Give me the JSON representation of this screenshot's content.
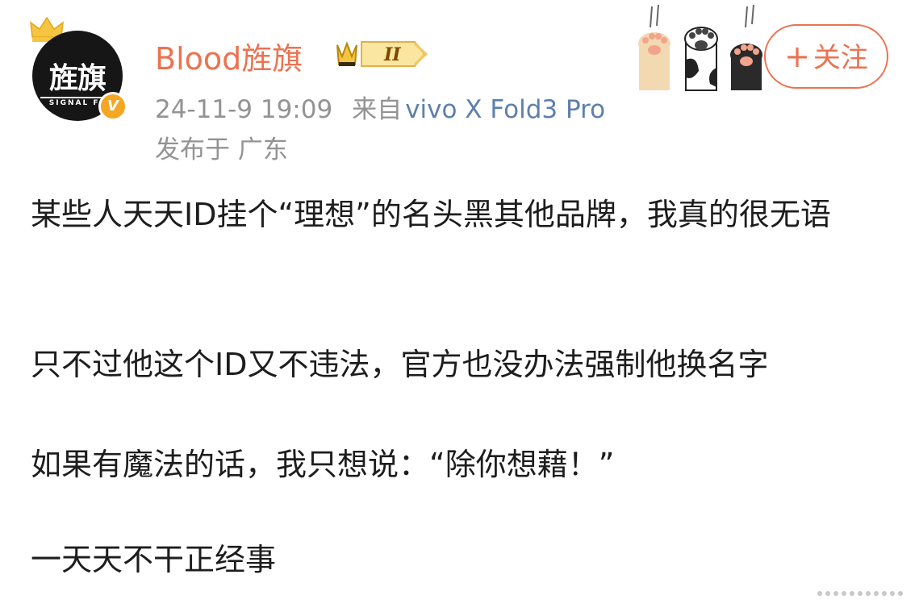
{
  "user": {
    "avatar_text": "旌旗",
    "avatar_sub": "SIGNAL FL",
    "verified_mark": "V",
    "name": "Blood旌旗",
    "level": "II"
  },
  "meta": {
    "time": "24-11-9 19:09",
    "from_label": "来自",
    "device": "vivo X Fold3 Pro",
    "location": "发布于 广东"
  },
  "follow": {
    "plus": "+",
    "label": "关注"
  },
  "post": {
    "paragraphs": [
      "某些人天天ID挂个“理想”的名头黑其他品牌，我真的很无语",
      "只不过他这个ID又不违法，官方也没办法强制他换名字",
      "如果有魔法的话，我只想说：“除你想藉！”",
      "一天天不干正经事"
    ]
  },
  "colors": {
    "username": "#eb7350",
    "device": "#5d7fad",
    "meta": "#939393",
    "crown": "#f5c542"
  },
  "icons": [
    "crown-icon",
    "verified-v-icon",
    "level-badge-icon",
    "cat-paws-icon",
    "more-dots-icon"
  ]
}
